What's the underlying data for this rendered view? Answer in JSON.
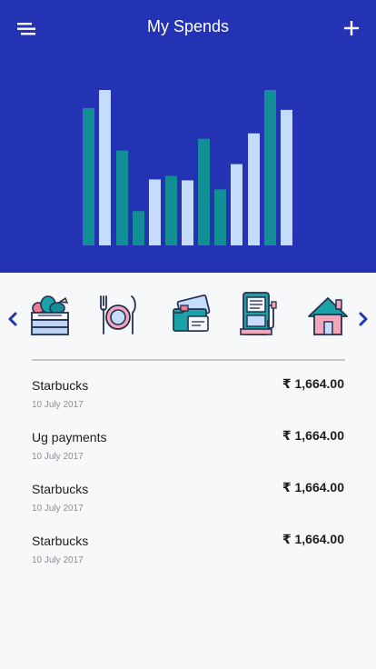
{
  "header": {
    "title": "My Spends",
    "background": "#2432b4",
    "menu_icon": "menu-icon",
    "add_icon": "plus-icon"
  },
  "chart_data": {
    "type": "bar",
    "series": [
      {
        "color": "#118f95",
        "values": [
          152,
          105,
          38,
          77,
          118,
          62,
          172
        ]
      },
      {
        "color": "#c6dcfd",
        "values": [
          172,
          73,
          72,
          90,
          124,
          150
        ]
      }
    ],
    "ylim": [
      0,
      172
    ]
  },
  "categories": [
    {
      "name": "groceries",
      "icon": "groceries-crate-icon"
    },
    {
      "name": "dining",
      "icon": "plate-fork-knife-icon"
    },
    {
      "name": "cards",
      "icon": "wallet-cards-icon"
    },
    {
      "name": "fuel",
      "icon": "fuel-pump-icon"
    },
    {
      "name": "home",
      "icon": "house-icon"
    }
  ],
  "transactions": [
    {
      "name": "Starbucks",
      "date": "10 July 2017",
      "amount": "₹ 1,664.00"
    },
    {
      "name": "Ug payments",
      "date": "10 July 2017",
      "amount": "₹ 1,664.00"
    },
    {
      "name": "Starbucks",
      "date": "10 July 2017",
      "amount": "₹ 1,664.00"
    },
    {
      "name": "Starbucks",
      "date": "10 July 2017",
      "amount": "₹ 1,664.00"
    }
  ]
}
